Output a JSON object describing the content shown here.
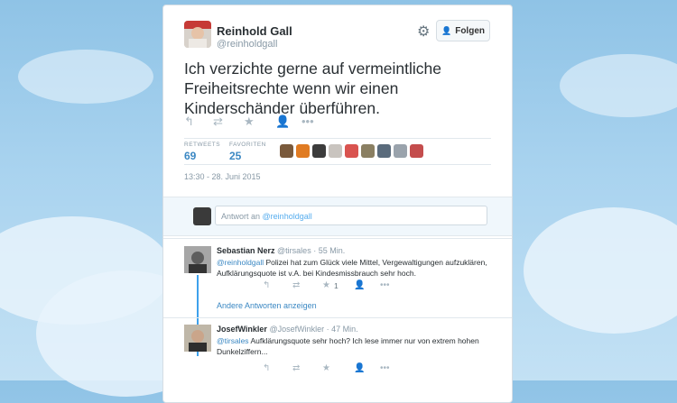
{
  "tweet": {
    "author_name": "Reinhold Gall",
    "author_handle": "@reinholdgall",
    "follow_label": "Folgen",
    "text": "Ich verzichte gerne auf vermeintliche Freiheitsrechte wenn wir einen Kinderschänder überführen.",
    "retweets_label": "RETWEETS",
    "retweets_count": "69",
    "favorites_label": "FAVORITEN",
    "favorites_count": "25",
    "timestamp": "13:30 - 28. Juni 2015",
    "icons": {
      "reply": "reply-icon",
      "retweet": "retweet-icon",
      "favorite": "star-icon",
      "more": "more-icon",
      "settings": "gear-icon",
      "follow": "person-add-icon"
    }
  },
  "reply_box": {
    "prefix": "Antwort an",
    "mention": "@reinholdgall"
  },
  "replies": [
    {
      "name": "Sebastian Nerz",
      "meta": "@tirsales · 55 Min.",
      "mention": "@reinholdgall",
      "text": " Polizei hat zum Glück viele Mittel, Vergewaltigungen aufzuklären, Aufklärungsquote ist v.A. bei Kindesmissbrauch sehr hoch.",
      "favorite_count": "1"
    },
    {
      "name": "JosefWinkler",
      "meta": "@JosefWinkler · 47 Min.",
      "mention": "@tirsales",
      "text": " Aufklärungsquote sehr hoch? Ich lese immer nur von extrem hohen Dunkelziffern...",
      "favorite_count": ""
    }
  ],
  "more_replies_label": "Andere Antworten anzeigen",
  "colors": {
    "link": "#3b88c3",
    "accent": "#55acee",
    "background": "#a9d3ef"
  }
}
